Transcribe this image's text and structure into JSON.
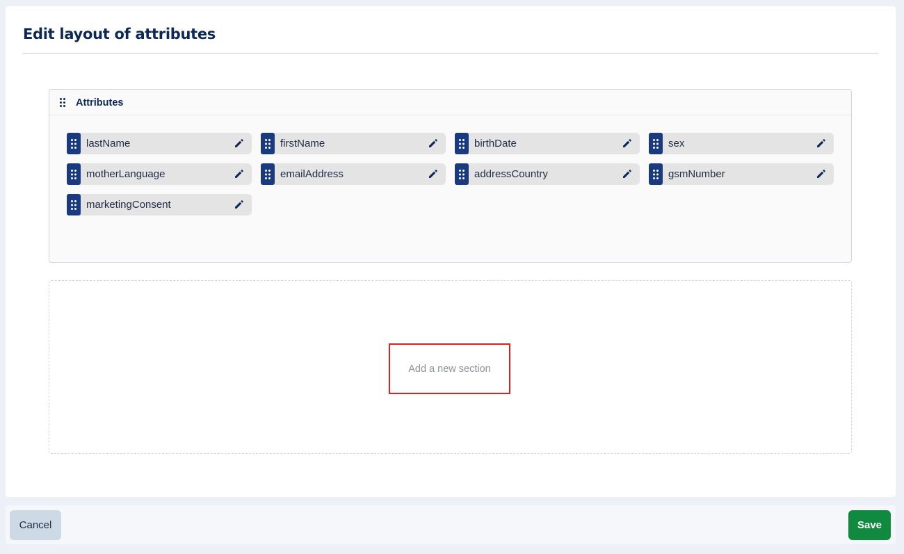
{
  "page": {
    "title": "Edit layout of attributes"
  },
  "section": {
    "title": "Attributes",
    "attributes": [
      {
        "label": "lastName"
      },
      {
        "label": "firstName"
      },
      {
        "label": "birthDate"
      },
      {
        "label": "sex"
      },
      {
        "label": "motherLanguage"
      },
      {
        "label": "emailAddress"
      },
      {
        "label": "addressCountry"
      },
      {
        "label": "gsmNumber"
      },
      {
        "label": "marketingConsent"
      }
    ]
  },
  "add_section": {
    "label": "Add a new section"
  },
  "footer": {
    "cancel_label": "Cancel",
    "save_label": "Save"
  },
  "colors": {
    "brand_navy": "#0e2855",
    "chip_handle": "#1a3a80",
    "save_green": "#0f8a3f",
    "highlight_red": "#e01e1e"
  },
  "icons": {
    "section_handle": "drag-handle-icon",
    "chip_handle": "drag-handle-icon",
    "chip_edit": "pencil-icon"
  }
}
